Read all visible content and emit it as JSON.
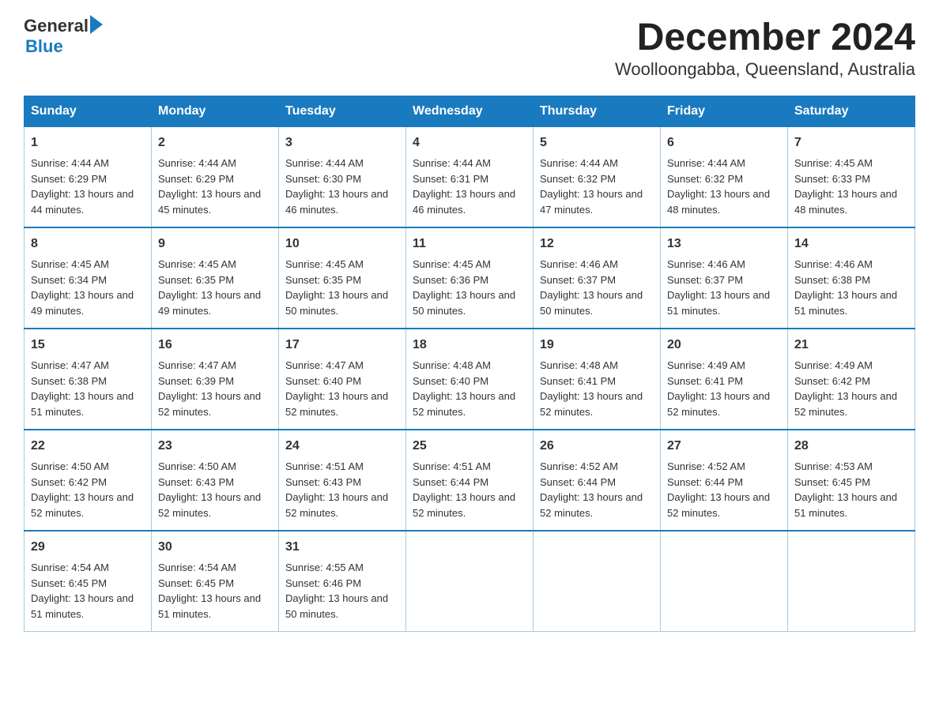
{
  "header": {
    "logo_general": "General",
    "logo_blue": "Blue",
    "title": "December 2024",
    "subtitle": "Woolloongabba, Queensland, Australia"
  },
  "days_of_week": [
    "Sunday",
    "Monday",
    "Tuesday",
    "Wednesday",
    "Thursday",
    "Friday",
    "Saturday"
  ],
  "weeks": [
    [
      {
        "day": "1",
        "sunrise": "4:44 AM",
        "sunset": "6:29 PM",
        "daylight": "13 hours and 44 minutes."
      },
      {
        "day": "2",
        "sunrise": "4:44 AM",
        "sunset": "6:29 PM",
        "daylight": "13 hours and 45 minutes."
      },
      {
        "day": "3",
        "sunrise": "4:44 AM",
        "sunset": "6:30 PM",
        "daylight": "13 hours and 46 minutes."
      },
      {
        "day": "4",
        "sunrise": "4:44 AM",
        "sunset": "6:31 PM",
        "daylight": "13 hours and 46 minutes."
      },
      {
        "day": "5",
        "sunrise": "4:44 AM",
        "sunset": "6:32 PM",
        "daylight": "13 hours and 47 minutes."
      },
      {
        "day": "6",
        "sunrise": "4:44 AM",
        "sunset": "6:32 PM",
        "daylight": "13 hours and 48 minutes."
      },
      {
        "day": "7",
        "sunrise": "4:45 AM",
        "sunset": "6:33 PM",
        "daylight": "13 hours and 48 minutes."
      }
    ],
    [
      {
        "day": "8",
        "sunrise": "4:45 AM",
        "sunset": "6:34 PM",
        "daylight": "13 hours and 49 minutes."
      },
      {
        "day": "9",
        "sunrise": "4:45 AM",
        "sunset": "6:35 PM",
        "daylight": "13 hours and 49 minutes."
      },
      {
        "day": "10",
        "sunrise": "4:45 AM",
        "sunset": "6:35 PM",
        "daylight": "13 hours and 50 minutes."
      },
      {
        "day": "11",
        "sunrise": "4:45 AM",
        "sunset": "6:36 PM",
        "daylight": "13 hours and 50 minutes."
      },
      {
        "day": "12",
        "sunrise": "4:46 AM",
        "sunset": "6:37 PM",
        "daylight": "13 hours and 50 minutes."
      },
      {
        "day": "13",
        "sunrise": "4:46 AM",
        "sunset": "6:37 PM",
        "daylight": "13 hours and 51 minutes."
      },
      {
        "day": "14",
        "sunrise": "4:46 AM",
        "sunset": "6:38 PM",
        "daylight": "13 hours and 51 minutes."
      }
    ],
    [
      {
        "day": "15",
        "sunrise": "4:47 AM",
        "sunset": "6:38 PM",
        "daylight": "13 hours and 51 minutes."
      },
      {
        "day": "16",
        "sunrise": "4:47 AM",
        "sunset": "6:39 PM",
        "daylight": "13 hours and 52 minutes."
      },
      {
        "day": "17",
        "sunrise": "4:47 AM",
        "sunset": "6:40 PM",
        "daylight": "13 hours and 52 minutes."
      },
      {
        "day": "18",
        "sunrise": "4:48 AM",
        "sunset": "6:40 PM",
        "daylight": "13 hours and 52 minutes."
      },
      {
        "day": "19",
        "sunrise": "4:48 AM",
        "sunset": "6:41 PM",
        "daylight": "13 hours and 52 minutes."
      },
      {
        "day": "20",
        "sunrise": "4:49 AM",
        "sunset": "6:41 PM",
        "daylight": "13 hours and 52 minutes."
      },
      {
        "day": "21",
        "sunrise": "4:49 AM",
        "sunset": "6:42 PM",
        "daylight": "13 hours and 52 minutes."
      }
    ],
    [
      {
        "day": "22",
        "sunrise": "4:50 AM",
        "sunset": "6:42 PM",
        "daylight": "13 hours and 52 minutes."
      },
      {
        "day": "23",
        "sunrise": "4:50 AM",
        "sunset": "6:43 PM",
        "daylight": "13 hours and 52 minutes."
      },
      {
        "day": "24",
        "sunrise": "4:51 AM",
        "sunset": "6:43 PM",
        "daylight": "13 hours and 52 minutes."
      },
      {
        "day": "25",
        "sunrise": "4:51 AM",
        "sunset": "6:44 PM",
        "daylight": "13 hours and 52 minutes."
      },
      {
        "day": "26",
        "sunrise": "4:52 AM",
        "sunset": "6:44 PM",
        "daylight": "13 hours and 52 minutes."
      },
      {
        "day": "27",
        "sunrise": "4:52 AM",
        "sunset": "6:44 PM",
        "daylight": "13 hours and 52 minutes."
      },
      {
        "day": "28",
        "sunrise": "4:53 AM",
        "sunset": "6:45 PM",
        "daylight": "13 hours and 51 minutes."
      }
    ],
    [
      {
        "day": "29",
        "sunrise": "4:54 AM",
        "sunset": "6:45 PM",
        "daylight": "13 hours and 51 minutes."
      },
      {
        "day": "30",
        "sunrise": "4:54 AM",
        "sunset": "6:45 PM",
        "daylight": "13 hours and 51 minutes."
      },
      {
        "day": "31",
        "sunrise": "4:55 AM",
        "sunset": "6:46 PM",
        "daylight": "13 hours and 50 minutes."
      },
      null,
      null,
      null,
      null
    ]
  ]
}
